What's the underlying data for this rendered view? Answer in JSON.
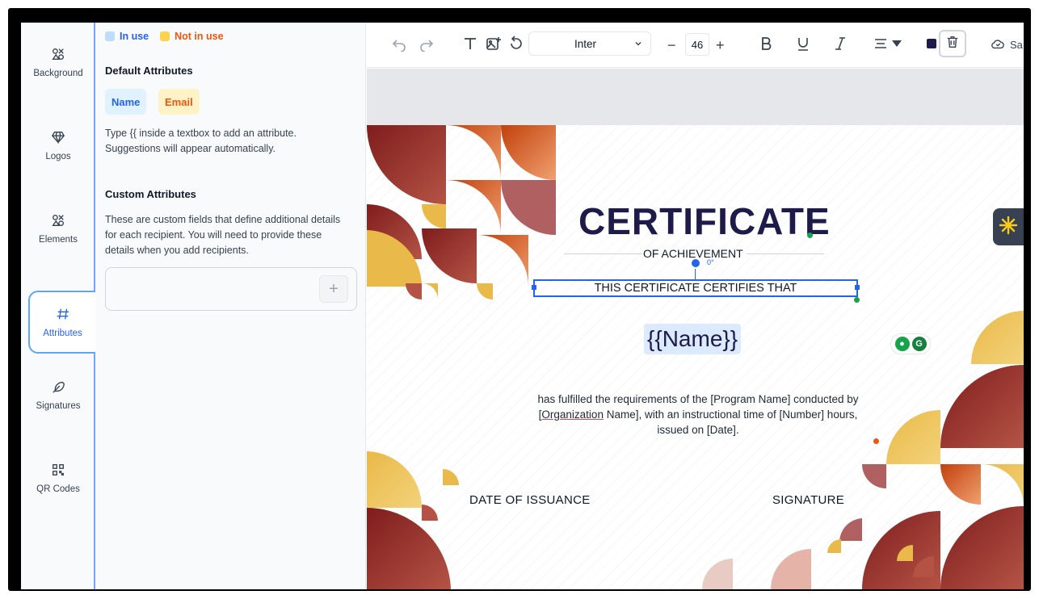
{
  "legend": {
    "in_use": "In use",
    "not_in_use": "Not in use",
    "in_use_color": "#bfdbfe",
    "not_in_use_color": "#fcd34d"
  },
  "sidebar": {
    "items": [
      {
        "label": "Background",
        "icon": "shapes-icon"
      },
      {
        "label": "Logos",
        "icon": "diamond-icon"
      },
      {
        "label": "Elements",
        "icon": "shapes-icon"
      },
      {
        "label": "Attributes",
        "icon": "hash-icon",
        "active": true
      },
      {
        "label": "Signatures",
        "icon": "feather-icon"
      },
      {
        "label": "QR Codes",
        "icon": "qr-icon"
      }
    ]
  },
  "panel": {
    "default_title": "Default Attributes",
    "chips": [
      "Name",
      "Email"
    ],
    "default_help": "Type {{ inside a textbox to add an attribute. Suggestions will appear automatically.",
    "custom_title": "Custom Attributes",
    "custom_help": "These are custom fields that define additional details for each recipient. You will need to provide these details when you add recipients.",
    "add_button": "+"
  },
  "toolbar": {
    "font": "Inter",
    "font_size": "46",
    "minus": "−",
    "plus": "+",
    "save": "Sa",
    "text_color": "#1e1b4b"
  },
  "certificate": {
    "title": "CERTIFICATE",
    "subtitle": "OF ACHIEVEMENT",
    "certifies": "THIS CERTIFICATE CERTIFIES THAT",
    "rotation": "0°",
    "name_placeholder": "{{Name}}",
    "body_1": "has fulfilled the requirements of the [Program Name] conducted by",
    "body_2a": "[",
    "body_2b": "Organization",
    "body_2c": " Name], with an instructional time of [Number] hours,",
    "body_3": "issued on [Date].",
    "date_label": "DATE OF ISSUANCE",
    "signature_label": "SIGNATURE"
  },
  "colors": {
    "accent": "#2563eb",
    "deep_red": "#7f1d1d",
    "gold": "#e9b949",
    "terracotta": "#c2410c"
  }
}
